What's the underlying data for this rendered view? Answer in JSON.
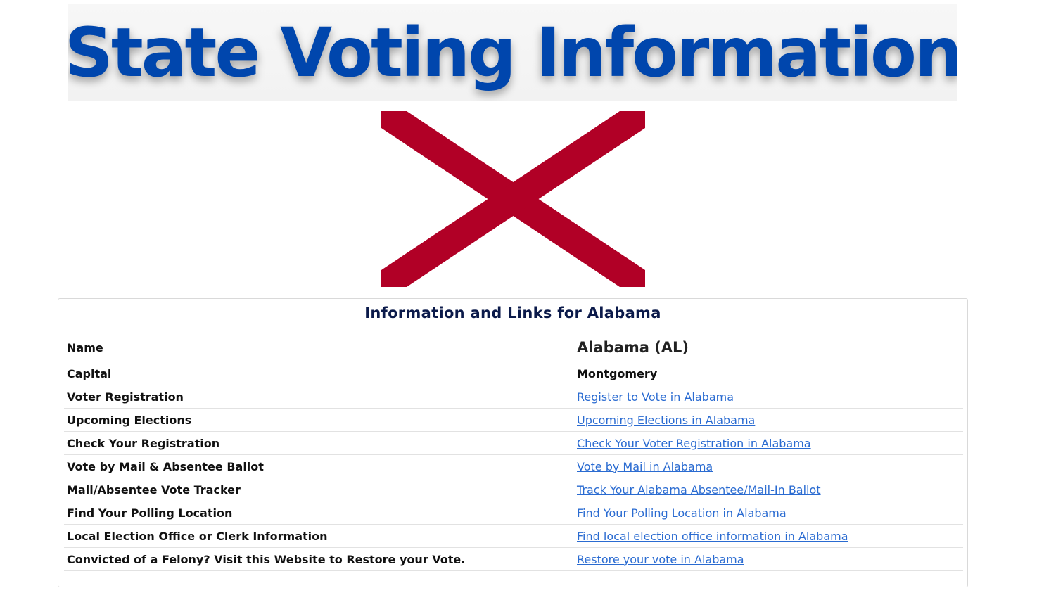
{
  "banner": {
    "title": "State Voting Information"
  },
  "colors": {
    "banner_blue": "#0046ad",
    "flag_red": "#b10026",
    "card_title": "#0b1a4a",
    "link": "#2a6bd1"
  },
  "card": {
    "title": "Information and Links for Alabama",
    "rows": [
      {
        "label": "Name",
        "value": "Alabama (AL)"
      },
      {
        "label": "Capital",
        "value": "Montgomery"
      },
      {
        "label": "Voter Registration",
        "value": "Register to Vote in Alabama"
      },
      {
        "label": "Upcoming Elections",
        "value": "Upcoming Elections in Alabama"
      },
      {
        "label": "Check Your Registration",
        "value": "Check Your Voter Registration in Alabama"
      },
      {
        "label": "Vote by Mail & Absentee Ballot",
        "value": "Vote by Mail in Alabama"
      },
      {
        "label": "Mail/Absentee Vote Tracker",
        "value": "Track Your Alabama Absentee/Mail-In Ballot"
      },
      {
        "label": "Find Your Polling Location",
        "value": "Find Your Polling Location in Alabama"
      },
      {
        "label": "Local Election Office or Clerk Information",
        "value": "Find local election office information in Alabama"
      },
      {
        "label": "Convicted of a Felony? Visit this Website to Restore your Vote.",
        "value": "Restore your vote in Alabama"
      }
    ]
  }
}
